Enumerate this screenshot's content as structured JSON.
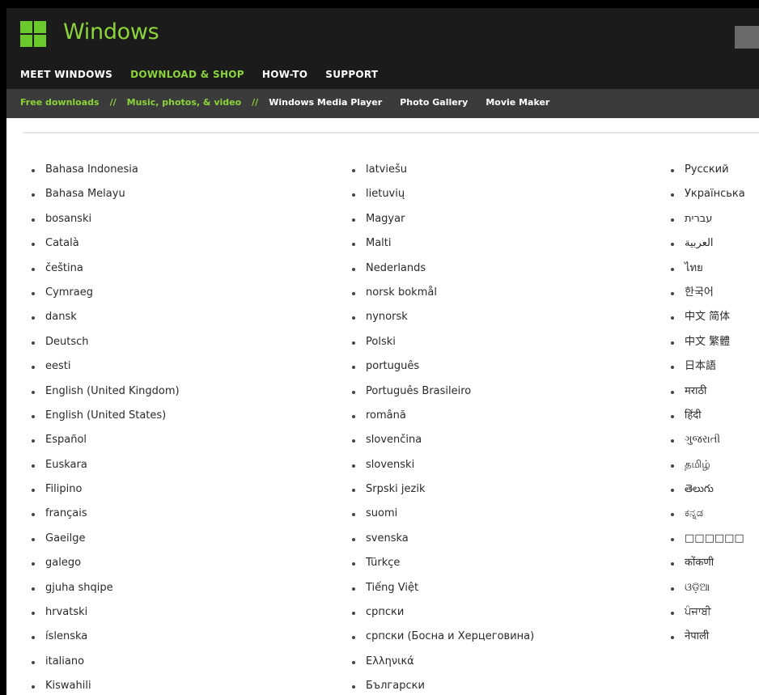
{
  "header": {
    "brand": "Windows",
    "nav": [
      {
        "label": "MEET WINDOWS"
      },
      {
        "label": "DOWNLOAD & SHOP"
      },
      {
        "label": "HOW-TO"
      },
      {
        "label": "SUPPORT"
      }
    ],
    "active_nav": "DOWNLOAD & SHOP"
  },
  "subnav": {
    "breadcrumbs": [
      {
        "label": "Free downloads"
      },
      {
        "label": "Music, photos, & video"
      }
    ],
    "separator": "//",
    "links": [
      {
        "label": "Windows Media Player"
      },
      {
        "label": "Photo Gallery"
      },
      {
        "label": "Movie Maker"
      }
    ]
  },
  "languages": {
    "column1": [
      "Bahasa Indonesia",
      "Bahasa Melayu",
      "bosanski",
      "Català",
      "čeština",
      "Cymraeg",
      "dansk",
      "Deutsch",
      "eesti",
      "English (United Kingdom)",
      "English (United States)",
      "Español",
      "Euskara",
      "Filipino",
      "français",
      "Gaeilge",
      "galego",
      "gjuha shqipe",
      "hrvatski",
      "íslenska",
      "italiano",
      "Kiswahili"
    ],
    "column2": [
      "latviešu",
      "lietuvių",
      "Magyar",
      "Malti",
      "Nederlands",
      "norsk bokmål",
      "nynorsk",
      "Polski",
      "português",
      "Português Brasileiro",
      "română",
      "slovenčina",
      "slovenski",
      "Srpski jezik",
      "suomi",
      "svenska",
      "Türkçe",
      "Tiếng Việt",
      "српски",
      "српски (Босна и Херцеговина)",
      "Ελληνικά",
      "Български"
    ],
    "column3": [
      "Русский",
      "Українська",
      "עברית",
      "العربية",
      "ไทย",
      "한국어",
      "中文 简体",
      "中文 繁體",
      "日本語",
      "मराठी",
      "हिंदी",
      "ગુજરાતી",
      "தமிழ்",
      "తెలుగు",
      "ಕನ್ನಡ",
      "□□□□□□",
      "कोंकणी",
      "ଓଡ଼ିଆ",
      "ਪੰਜਾਬੀ",
      "नेपाली"
    ]
  },
  "colors": {
    "accent_green": "#8bd43a",
    "header_bg": "#1b1b1b",
    "subnav_bg": "#3b3b3b"
  }
}
